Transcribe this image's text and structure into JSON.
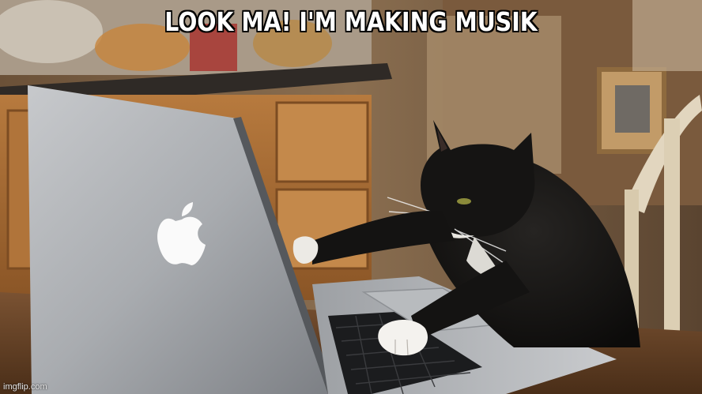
{
  "meme": {
    "caption": "LOOK MA! I'M MAKING MUSIK",
    "watermark": "imgflip.com"
  },
  "scene": {
    "subject": "tuxedo-cat",
    "object": "laptop",
    "logo": "apple-logo-icon"
  }
}
